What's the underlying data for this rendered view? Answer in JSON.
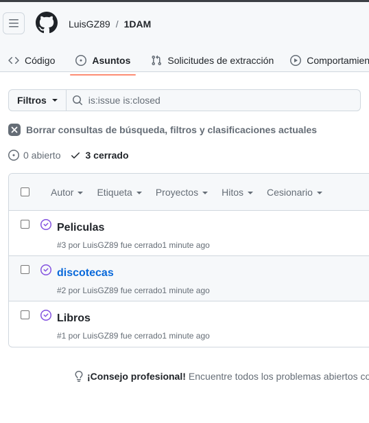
{
  "header": {
    "owner": "LuisGZ89",
    "separator": "/",
    "repo": "1DAM"
  },
  "tabs": [
    {
      "label": "Código",
      "icon": "code-icon",
      "selected": false
    },
    {
      "label": "Asuntos",
      "icon": "issue-opened-icon",
      "selected": true
    },
    {
      "label": "Solicitudes de extracción",
      "icon": "git-pull-request-icon",
      "selected": false
    },
    {
      "label": "Comportamiento",
      "icon": "play-icon",
      "selected": false
    }
  ],
  "filters": {
    "button_label": "Filtros",
    "search_value": "is:issue is:closed"
  },
  "clear_filters_label": "Borrar consultas de búsqueda, filtros y clasificaciones actuales",
  "states": {
    "open_label": "0 abierto",
    "closed_label": "3 cerrado"
  },
  "list_header": {
    "filters": [
      "Autor",
      "Etiqueta",
      "Proyectos",
      "Hitos",
      "Cesionario"
    ]
  },
  "issues": [
    {
      "title": "Peliculas",
      "meta": "#3 por LuisGZ89 fue cerrado1 minute ago"
    },
    {
      "title": "discotecas",
      "meta": "#2 por LuisGZ89 fue cerrado1 minute ago"
    },
    {
      "title": "Libros",
      "meta": "#1 por LuisGZ89 fue cerrado1 minute ago"
    }
  ],
  "tip": {
    "strong": "¡Consejo profesional!",
    "text": "Encuentre todos los problemas abiertos con"
  },
  "colors": {
    "closed_purple": "#8250df",
    "tab_underline": "#fd8c73",
    "link_blue": "#0969da"
  }
}
